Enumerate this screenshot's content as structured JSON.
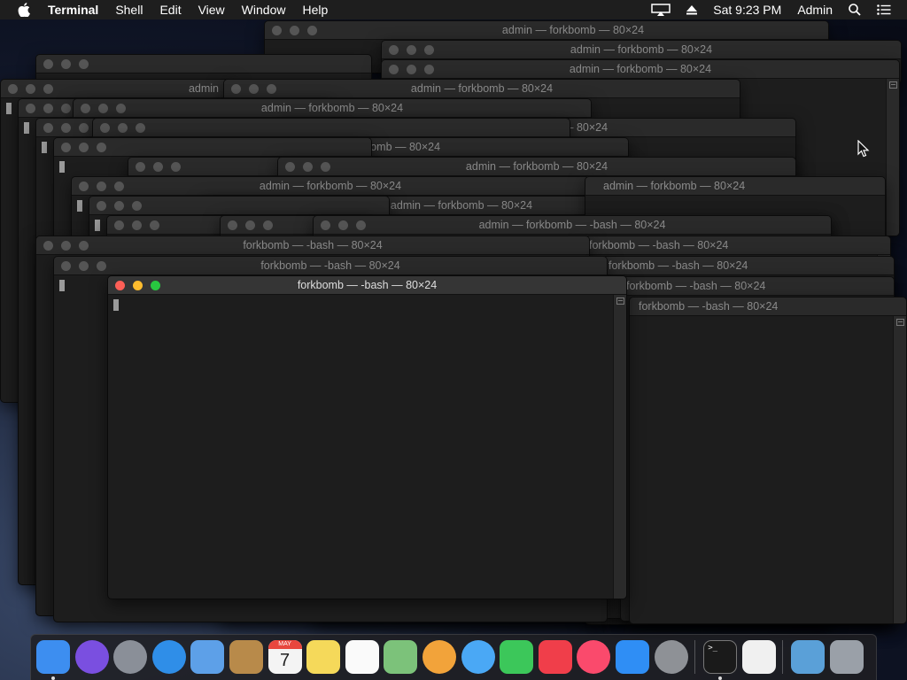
{
  "menubar": {
    "app_name": "Terminal",
    "menus": [
      "Shell",
      "Edit",
      "View",
      "Window",
      "Help"
    ],
    "clock": "Sat 9:23 PM",
    "user": "Admin"
  },
  "active_window": {
    "title": "forkbomb — -bash — 80×24"
  },
  "background_windows": [
    {
      "title": "admin — forkbomb — 80×24"
    },
    {
      "title": "admin — forkbomb — 80×24"
    },
    {
      "title": "admin — forkbomb — 80×24"
    },
    {
      "title": "admin"
    },
    {
      "title": "admin — forkbomb — 80×24"
    },
    {
      "title": "admin — forkbomb — 80×24"
    },
    {
      "title": "admin — forkbomb — 80×24"
    },
    {
      "title": "admin — forkbomb — 80×24"
    },
    {
      "title": "admin — forkbomb — 80×24"
    },
    {
      "title": "admin — forkbomb — 80×24"
    },
    {
      "title": "admin — forkbomb — 80×24"
    },
    {
      "title": "admin — forkbomb — 80×24"
    },
    {
      "title": "admin — forkbomb — -bash — 80×24"
    },
    {
      "title": "forkbomb — -bash — 80×24"
    },
    {
      "title": "forkbomb — -bash — 80×24"
    },
    {
      "title": "forkbomb — -bash — 80×24"
    },
    {
      "title": "forkbomb — -bash — 80×24"
    },
    {
      "title": "forkbomb — -bash — 80×24"
    },
    {
      "title": "forkbomb — -bash — 80×24"
    }
  ],
  "dock": {
    "apps": [
      {
        "name": "finder-icon",
        "color": "#3d8ef0",
        "running": true
      },
      {
        "name": "siri-icon",
        "color": "#7a4fe0",
        "running": false
      },
      {
        "name": "launchpad-icon",
        "color": "#8a8f98",
        "running": false
      },
      {
        "name": "safari-icon",
        "color": "#2f8ee8",
        "running": false
      },
      {
        "name": "mail-icon",
        "color": "#5da0e8",
        "running": false
      },
      {
        "name": "contacts-icon",
        "color": "#b88a4a",
        "running": false
      },
      {
        "name": "calendar-icon",
        "color": "#f4f4f4",
        "running": false
      },
      {
        "name": "notes-icon",
        "color": "#f5d95a",
        "running": false
      },
      {
        "name": "reminders-icon",
        "color": "#fafafa",
        "running": false
      },
      {
        "name": "maps-icon",
        "color": "#7cc27a",
        "running": false
      },
      {
        "name": "photos-icon",
        "color": "#f2a33a",
        "running": false
      },
      {
        "name": "messages-icon",
        "color": "#4aa8f5",
        "running": false
      },
      {
        "name": "facetime-icon",
        "color": "#3cc75a",
        "running": false
      },
      {
        "name": "news-icon",
        "color": "#f03e4a",
        "running": false
      },
      {
        "name": "music-icon",
        "color": "#fa4a6c",
        "running": false
      },
      {
        "name": "app-store-icon",
        "color": "#2f8ef5",
        "running": false
      },
      {
        "name": "system-preferences-icon",
        "color": "#8e9196",
        "running": false
      },
      {
        "name": "terminal-icon",
        "color": "#1a1a1a",
        "running": true
      },
      {
        "name": "textedit-icon",
        "color": "#f0f0f0",
        "running": false
      },
      {
        "name": "downloads-folder-icon",
        "color": "#5aa0d8",
        "running": false
      },
      {
        "name": "trash-icon",
        "color": "#9aa0a8",
        "running": false
      }
    ],
    "calendar_month": "MAY",
    "calendar_day": "7"
  }
}
